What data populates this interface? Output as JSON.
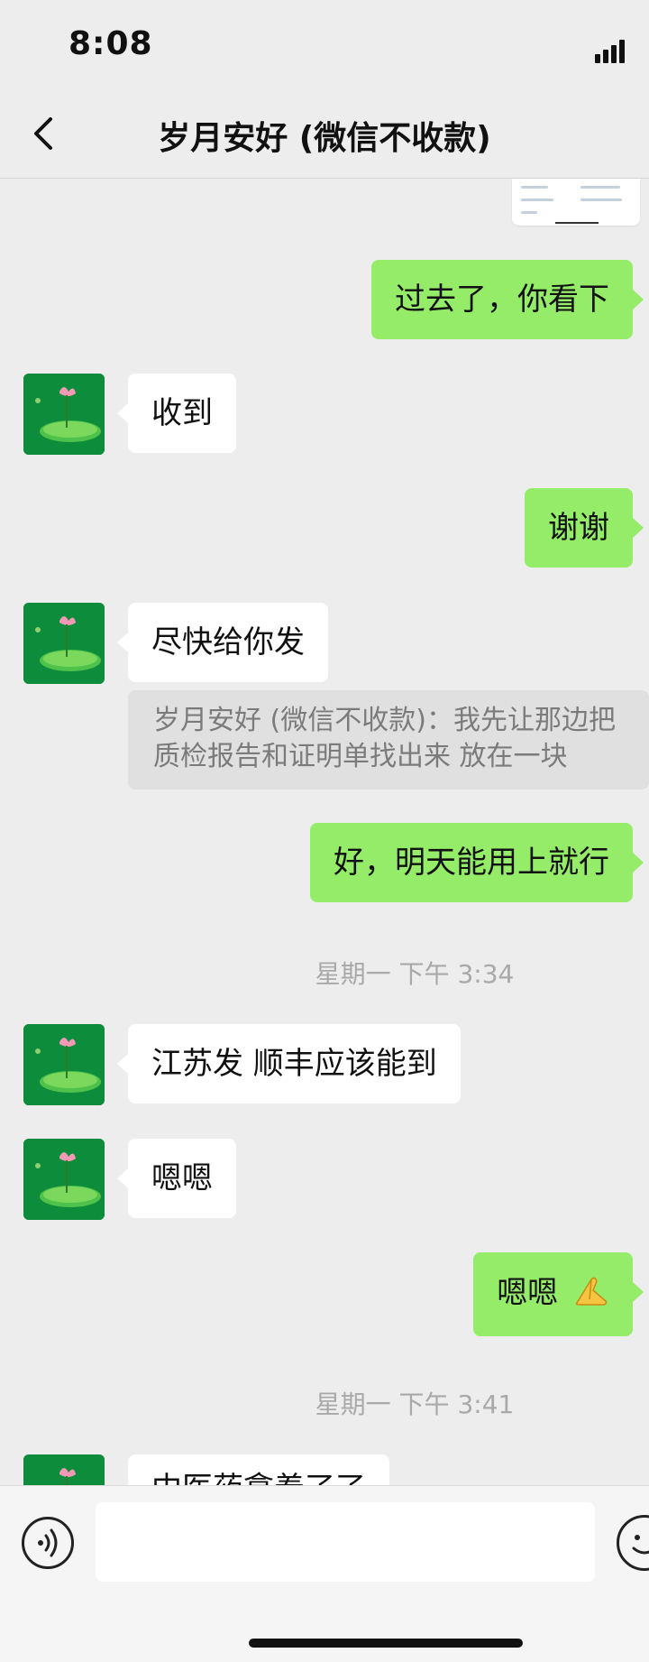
{
  "status_bar": {
    "time": "8:08"
  },
  "header": {
    "title": "岁月安好 (微信不收款)"
  },
  "messages": {
    "m1": "过去了，你看下",
    "m2": "收到",
    "m3": "谢谢",
    "m4": "尽快给你发",
    "m4_quote": "岁月安好 (微信不收款)：我先让那边把质检报告和证明单找出来  放在一块",
    "m5": "好，明天能用上就行",
    "ts1": "星期一 下午 3:34",
    "m6": "江苏发  顺丰应该能到",
    "m7": "嗯嗯",
    "m8": "嗯嗯",
    "ts2": "星期一 下午 3:41",
    "m9_partial": "中医药拿着了了"
  },
  "icons": {
    "back": "chevron-left-icon",
    "voice": "voice-icon",
    "emoji": "emoji-icon",
    "pray": "folded-hands-emoji"
  },
  "colors": {
    "sent_bubble": "#95ec69",
    "received_bubble": "#ffffff",
    "background": "#ededed"
  }
}
